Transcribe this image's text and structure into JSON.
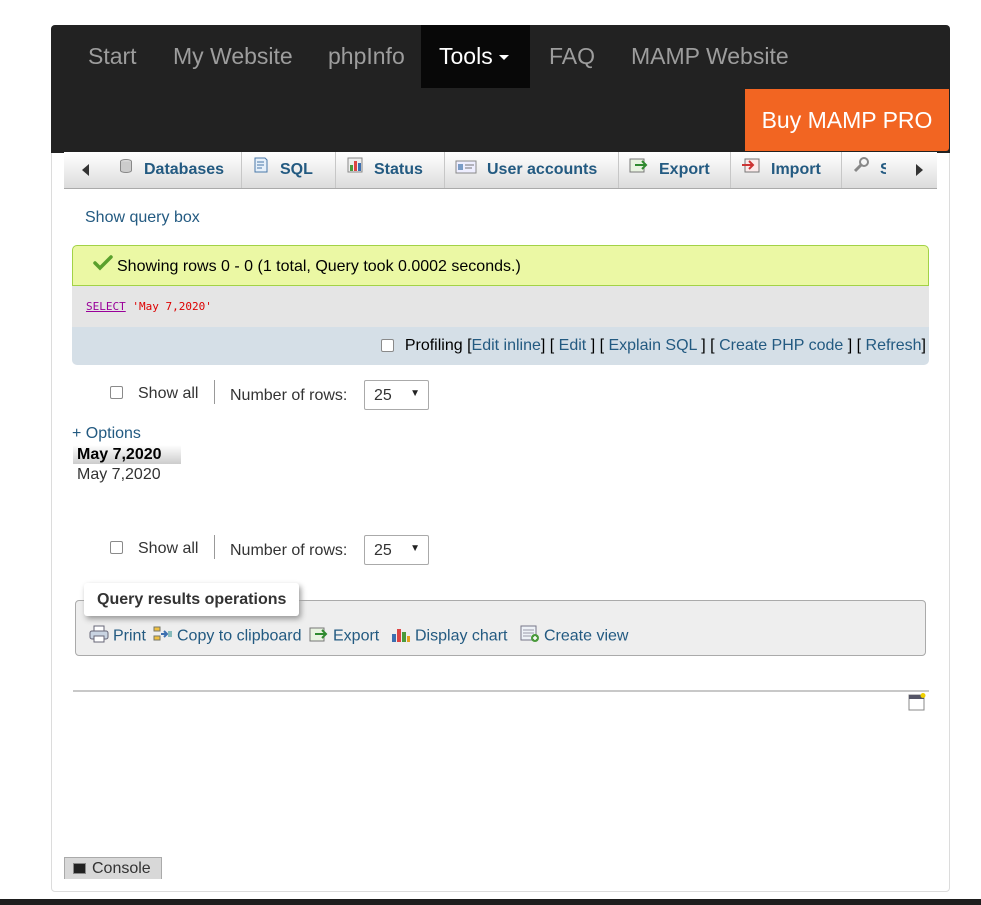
{
  "topnav": {
    "items": [
      {
        "label": "Start"
      },
      {
        "label": "My Website"
      },
      {
        "label": "phpInfo"
      },
      {
        "label": "Tools"
      },
      {
        "label": "FAQ"
      },
      {
        "label": "MAMP Website"
      }
    ],
    "buy_label": "Buy MAMP PRO"
  },
  "tabs": [
    {
      "label": "Databases",
      "icon": "database-icon"
    },
    {
      "label": "SQL",
      "icon": "sql-icon"
    },
    {
      "label": "Status",
      "icon": "status-icon"
    },
    {
      "label": "User accounts",
      "icon": "user-accounts-icon"
    },
    {
      "label": "Export",
      "icon": "export-icon"
    },
    {
      "label": "Import",
      "icon": "import-icon"
    },
    {
      "label": "S",
      "icon": "wrench-icon"
    }
  ],
  "show_query_box": "Show query box",
  "message": {
    "text": "Showing rows 0 - 0 (1 total, Query took 0.0002 seconds.)"
  },
  "sql": {
    "keyword": "SELECT",
    "string": "'May 7,2020'"
  },
  "sqltools": {
    "profiling": "Profiling",
    "edit_inline": "Edit inline",
    "edit": "Edit",
    "explain": "Explain SQL",
    "php": "Create PHP code",
    "refresh": "Refresh"
  },
  "navigation": {
    "show_all": "Show all",
    "number_of_rows": "Number of rows:",
    "rows_value": "25"
  },
  "options_label": "+ Options",
  "results": {
    "column": "May 7,2020",
    "value": "May 7,2020"
  },
  "operations": {
    "title": "Query results operations",
    "print": "Print",
    "copy": "Copy to clipboard",
    "export": "Export",
    "chart": "Display chart",
    "view": "Create view"
  },
  "console_label": "Console",
  "colors": {
    "navbar": "#222222",
    "buy": "#f26522",
    "link": "#235a81",
    "success_bg": "#ebf8a4"
  }
}
